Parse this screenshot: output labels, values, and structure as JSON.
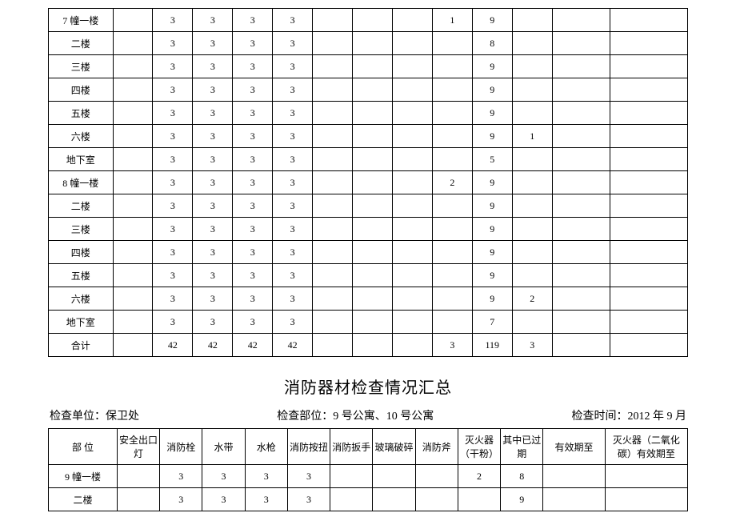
{
  "table1": {
    "rows": [
      {
        "loc": "7 幢一楼",
        "c": [
          "",
          "3",
          "3",
          "3",
          "3",
          "",
          "",
          "",
          "1",
          "9",
          "",
          "",
          "",
          ""
        ]
      },
      {
        "loc": "二楼",
        "c": [
          "",
          "3",
          "3",
          "3",
          "3",
          "",
          "",
          "",
          "",
          "8",
          "",
          "",
          "",
          ""
        ]
      },
      {
        "loc": "三楼",
        "c": [
          "",
          "3",
          "3",
          "3",
          "3",
          "",
          "",
          "",
          "",
          "9",
          "",
          "",
          "",
          ""
        ]
      },
      {
        "loc": "四楼",
        "c": [
          "",
          "3",
          "3",
          "3",
          "3",
          "",
          "",
          "",
          "",
          "9",
          "",
          "",
          "",
          ""
        ]
      },
      {
        "loc": "五楼",
        "c": [
          "",
          "3",
          "3",
          "3",
          "3",
          "",
          "",
          "",
          "",
          "9",
          "",
          "",
          "",
          ""
        ]
      },
      {
        "loc": "六楼",
        "c": [
          "",
          "3",
          "3",
          "3",
          "3",
          "",
          "",
          "",
          "",
          "9",
          "1",
          "",
          "",
          ""
        ]
      },
      {
        "loc": "地下室",
        "c": [
          "",
          "3",
          "3",
          "3",
          "3",
          "",
          "",
          "",
          "",
          "5",
          "",
          "",
          "",
          ""
        ]
      },
      {
        "loc": "8 幢一楼",
        "c": [
          "",
          "3",
          "3",
          "3",
          "3",
          "",
          "",
          "",
          "2",
          "9",
          "",
          "",
          "",
          ""
        ]
      },
      {
        "loc": "二楼",
        "c": [
          "",
          "3",
          "3",
          "3",
          "3",
          "",
          "",
          "",
          "",
          "9",
          "",
          "",
          "",
          ""
        ]
      },
      {
        "loc": "三楼",
        "c": [
          "",
          "3",
          "3",
          "3",
          "3",
          "",
          "",
          "",
          "",
          "9",
          "",
          "",
          "",
          ""
        ]
      },
      {
        "loc": "四楼",
        "c": [
          "",
          "3",
          "3",
          "3",
          "3",
          "",
          "",
          "",
          "",
          "9",
          "",
          "",
          "",
          ""
        ]
      },
      {
        "loc": "五楼",
        "c": [
          "",
          "3",
          "3",
          "3",
          "3",
          "",
          "",
          "",
          "",
          "9",
          "",
          "",
          "",
          ""
        ]
      },
      {
        "loc": "六楼",
        "c": [
          "",
          "3",
          "3",
          "3",
          "3",
          "",
          "",
          "",
          "",
          "9",
          "2",
          "",
          "",
          ""
        ]
      },
      {
        "loc": "地下室",
        "c": [
          "",
          "3",
          "3",
          "3",
          "3",
          "",
          "",
          "",
          "",
          "7",
          "",
          "",
          "",
          ""
        ]
      },
      {
        "loc": "合计",
        "c": [
          "",
          "42",
          "42",
          "42",
          "42",
          "",
          "",
          "",
          "3",
          "119",
          "3",
          "",
          "",
          ""
        ]
      }
    ]
  },
  "section2": {
    "title": "消防器材检查情况汇总",
    "meta": {
      "unit_label": "检查单位：保卫处",
      "area_label": "检查部位：9 号公寓、10 号公寓",
      "time_label": "检查时间：2012 年 9 月"
    },
    "headers": [
      "部 位",
      "安全出口灯",
      "消防栓",
      "水带",
      "水枪",
      "消防按扭",
      "消防扳手",
      "玻璃破碎",
      "消防斧",
      "灭火器（干粉）",
      "其中已过期",
      "有效期至",
      "灭火器（二氧化碳）有效期至"
    ],
    "rows": [
      {
        "loc": "9 幢一楼",
        "c": [
          "",
          "3",
          "3",
          "3",
          "3",
          "",
          "",
          "",
          "2",
          "8",
          "",
          "",
          "",
          ""
        ]
      },
      {
        "loc": "二楼",
        "c": [
          "",
          "3",
          "3",
          "3",
          "3",
          "",
          "",
          "",
          "",
          "9",
          "",
          "",
          "",
          ""
        ]
      }
    ]
  },
  "chart_data": [
    {
      "type": "table",
      "title": "消防器材检查情况 (7幢/8幢)",
      "columns": [
        "部位",
        "安全出口灯",
        "消防栓",
        "水带",
        "水枪",
        "消防按扭",
        "消防扳手",
        "玻璃破碎",
        "消防斧",
        "灭火器（干粉）",
        "其中已过期",
        "有效期至",
        "灭火器（二氧化碳）有效期至",
        ""
      ],
      "rows": [
        [
          "7 幢一楼",
          "",
          "3",
          "3",
          "3",
          "3",
          "",
          "",
          "",
          "1",
          "9",
          "",
          "",
          "",
          ""
        ],
        [
          "二楼",
          "",
          "3",
          "3",
          "3",
          "3",
          "",
          "",
          "",
          "",
          "8",
          "",
          "",
          "",
          ""
        ],
        [
          "三楼",
          "",
          "3",
          "3",
          "3",
          "3",
          "",
          "",
          "",
          "",
          "9",
          "",
          "",
          "",
          ""
        ],
        [
          "四楼",
          "",
          "3",
          "3",
          "3",
          "3",
          "",
          "",
          "",
          "",
          "9",
          "",
          "",
          "",
          ""
        ],
        [
          "五楼",
          "",
          "3",
          "3",
          "3",
          "3",
          "",
          "",
          "",
          "",
          "9",
          "",
          "",
          "",
          ""
        ],
        [
          "六楼",
          "",
          "3",
          "3",
          "3",
          "3",
          "",
          "",
          "",
          "",
          "9",
          "1",
          "",
          "",
          ""
        ],
        [
          "地下室",
          "",
          "3",
          "3",
          "3",
          "3",
          "",
          "",
          "",
          "",
          "5",
          "",
          "",
          "",
          ""
        ],
        [
          "8 幢一楼",
          "",
          "3",
          "3",
          "3",
          "3",
          "",
          "",
          "",
          "2",
          "9",
          "",
          "",
          "",
          ""
        ],
        [
          "二楼",
          "",
          "3",
          "3",
          "3",
          "3",
          "",
          "",
          "",
          "",
          "9",
          "",
          "",
          "",
          ""
        ],
        [
          "三楼",
          "",
          "3",
          "3",
          "3",
          "3",
          "",
          "",
          "",
          "",
          "9",
          "",
          "",
          "",
          ""
        ],
        [
          "四楼",
          "",
          "3",
          "3",
          "3",
          "3",
          "",
          "",
          "",
          "",
          "9",
          "",
          "",
          "",
          ""
        ],
        [
          "五楼",
          "",
          "3",
          "3",
          "3",
          "3",
          "",
          "",
          "",
          "",
          "9",
          "",
          "",
          "",
          ""
        ],
        [
          "六楼",
          "",
          "3",
          "3",
          "3",
          "3",
          "",
          "",
          "",
          "",
          "9",
          "2",
          "",
          "",
          ""
        ],
        [
          "地下室",
          "",
          "3",
          "3",
          "3",
          "3",
          "",
          "",
          "",
          "",
          "7",
          "",
          "",
          "",
          ""
        ],
        [
          "合计",
          "",
          "42",
          "42",
          "42",
          "42",
          "",
          "",
          "",
          "3",
          "119",
          "3",
          "",
          "",
          ""
        ]
      ]
    },
    {
      "type": "table",
      "title": "消防器材检查情况汇总 (9幢/10幢)",
      "columns": [
        "部位",
        "安全出口灯",
        "消防栓",
        "水带",
        "水枪",
        "消防按扭",
        "消防扳手",
        "玻璃破碎",
        "消防斧",
        "灭火器（干粉）",
        "其中已过期",
        "有效期至",
        "灭火器（二氧化碳）有效期至"
      ],
      "rows": [
        [
          "9 幢一楼",
          "",
          "3",
          "3",
          "3",
          "3",
          "",
          "",
          "",
          "2",
          "8",
          "",
          "",
          ""
        ],
        [
          "二楼",
          "",
          "3",
          "3",
          "3",
          "3",
          "",
          "",
          "",
          "",
          "9",
          "",
          "",
          ""
        ]
      ]
    }
  ]
}
